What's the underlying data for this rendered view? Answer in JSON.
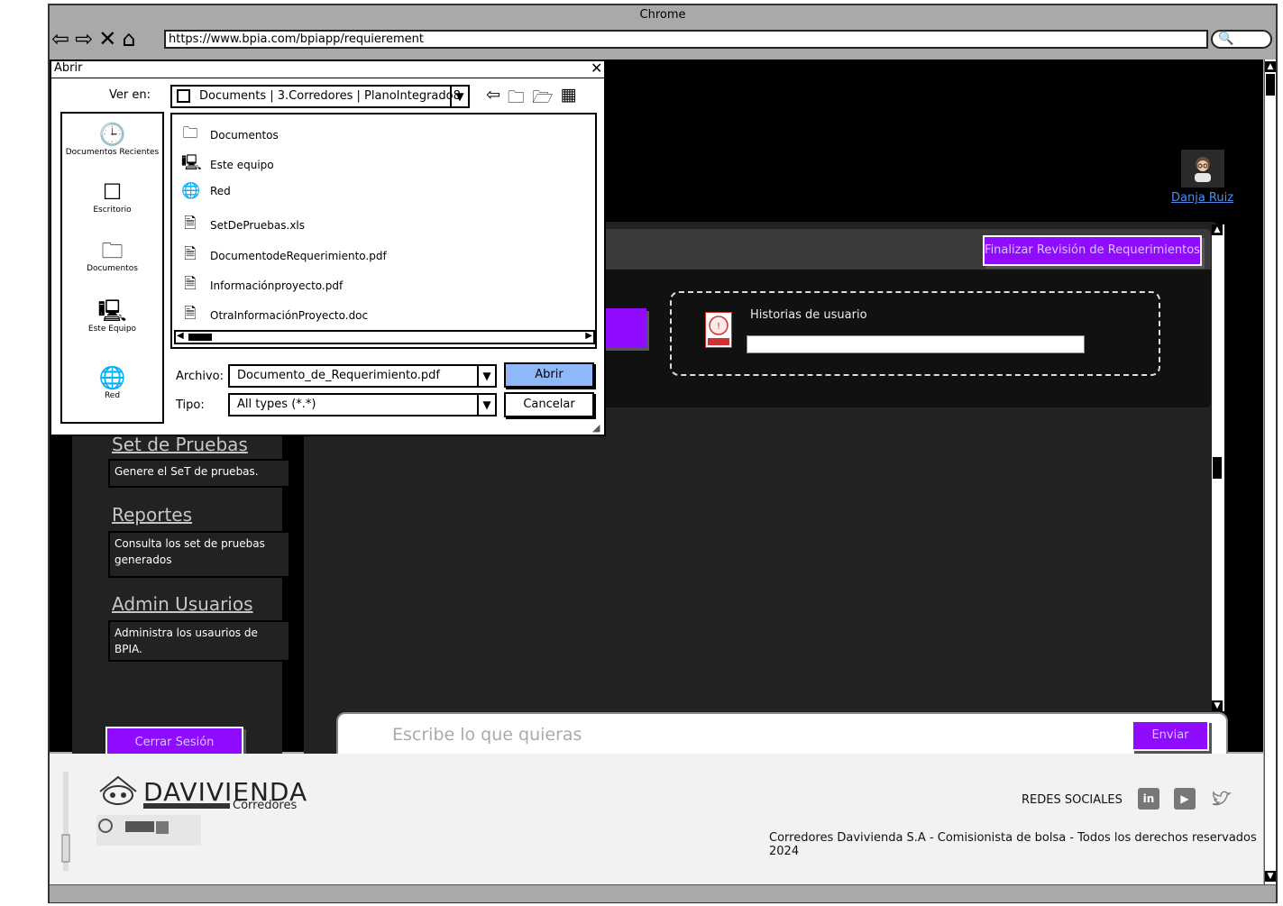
{
  "browser": {
    "title": "Chrome",
    "url": "https://www.bpia.com/bpiapp/requierement",
    "search_glyph": "🔍"
  },
  "user": {
    "name": "Danja Ruiz"
  },
  "main": {
    "finalize_label": "Finalizar Revisión de Requerimientos",
    "story_title": "Historias de usuario",
    "chat_placeholder": "Escribe lo que quieras",
    "send_label": "Enviar"
  },
  "sidebar": {
    "items": [
      {
        "label": "Set de Pruebas",
        "description": "Genere el SeT de pruebas."
      },
      {
        "label": "Reportes",
        "description": "Consulta los set de pruebas generados"
      },
      {
        "label": "Admin Usuarios",
        "description": "Administra los usaurios de BPIA."
      }
    ],
    "logout_label": "Cerrar Sesión"
  },
  "footer": {
    "brand": "DAVIVIENDA",
    "brand_sub": "Corredores",
    "social_label": "REDES SOCIALES",
    "copyright": "Corredores Davivienda S.A - Comisionista de bolsa - Todos los derechos reservados 2024"
  },
  "dialog": {
    "title": "Abrir",
    "look_in_label": "Ver en:",
    "look_in_value": "Documents | 3.Corredores | PlanoIntegrado8",
    "places": [
      {
        "label": "Documentos Recientes",
        "icon": "clock-icon"
      },
      {
        "label": "Escritorio",
        "icon": "desktop-icon"
      },
      {
        "label": "Documentos",
        "icon": "folder-icon"
      },
      {
        "label": "Este Equipo",
        "icon": "computer-icon"
      },
      {
        "label": "Red",
        "icon": "globe-icon"
      }
    ],
    "files": [
      {
        "name": "Documentos",
        "icon": "folder-icon"
      },
      {
        "name": "Este equipo",
        "icon": "computer-icon"
      },
      {
        "name": "Red",
        "icon": "globe-icon"
      },
      {
        "name": "SetDePruebas.xls",
        "icon": "excel-file-icon"
      },
      {
        "name": "DocumentodeRequerimiento.pdf",
        "icon": "pdf-file-icon"
      },
      {
        "name": "Informaciónproyecto.pdf",
        "icon": "pdf-file-icon"
      },
      {
        "name": "OtraInformaciónProyecto.doc",
        "icon": "word-file-icon"
      }
    ],
    "file_label": "Archivo:",
    "file_value": "Documento_de_Requerimiento.pdf",
    "type_label": "Tipo:",
    "type_value": "All types (*.*)",
    "open_label": "Abrir",
    "cancel_label": "Cancelar"
  },
  "colors": {
    "accent": "#8f0cff",
    "link": "#4b8ff0",
    "open_button": "#8fb8f8"
  }
}
